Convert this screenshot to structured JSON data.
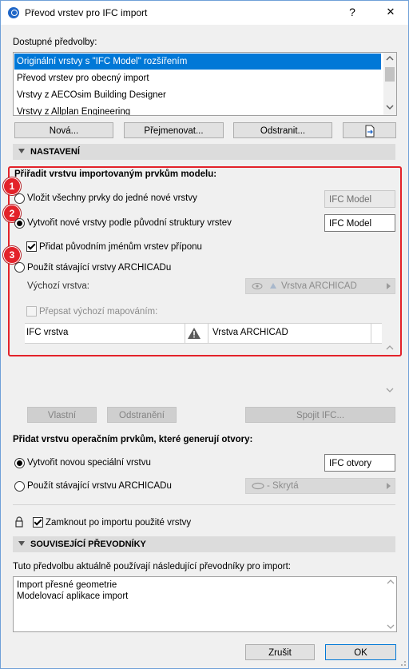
{
  "window": {
    "title": "Převod vrstev pro IFC import",
    "help": "?",
    "close": "✕"
  },
  "presets": {
    "label": "Dostupné předvolby:",
    "items": [
      "Originální vrstvy s \"IFC Model\" rozšířením",
      "Převod vrstev pro obecný import",
      "Vrstvy z AECOsim Building Designer",
      "Vrstvy z Allplan Engineering"
    ],
    "selected_index": 0
  },
  "preset_buttons": {
    "new": "Nová...",
    "rename": "Přejmenovat...",
    "delete": "Odstranit..."
  },
  "settings": {
    "header": "NASTAVENÍ",
    "assign_label": "Přiřadit vrstvu importovaným prvkům modelu:",
    "opt1_label": "Vložit všechny prvky do jedné nové vrstvy",
    "opt1_field": "IFC Model",
    "opt2_label": "Vytvořit nové vrstvy podle původní struktury vrstev",
    "opt2_field": "IFC Model",
    "suffix_label": "Přidat původním jménům vrstev příponu",
    "opt3_label": "Použít stávající vrstvy ARCHICADu",
    "default_layer_label": "Výchozí vrstva:",
    "default_layer_value": "Vrstva ARCHICAD",
    "override_label": "Přepsat výchozí mapováním:",
    "table": {
      "col1": "IFC vrstva",
      "col2": "Vrstva ARCHICAD"
    },
    "badges": [
      "1",
      "2",
      "3"
    ],
    "custom_button": "Vlastní",
    "remove_button": "Odstranění",
    "connect_button": "Spojit IFC..."
  },
  "opening": {
    "label": "Přidat vrstvu operačním prvkům, které generují otvory:",
    "opt1_label": "Vytvořit novou speciální vrstvu",
    "opt1_field": "IFC otvory",
    "opt2_label": "Použít stávající vrstvu ARCHICADu",
    "opt2_value": "- Skrytá"
  },
  "lock": {
    "label": "Zamknout po importu použité vrstvy"
  },
  "translators": {
    "header": "SOUVISEJÍCÍ PŘEVODNÍKY",
    "info": "Tuto předvolbu aktuálně používají následující převodníky pro import:",
    "lines": [
      "Import přesné geometrie",
      "Modelovací aplikace import"
    ]
  },
  "footer": {
    "cancel": "Zrušit",
    "ok": "OK"
  },
  "colors": {
    "accent": "#0078d7",
    "highlight": "#e3222a"
  }
}
